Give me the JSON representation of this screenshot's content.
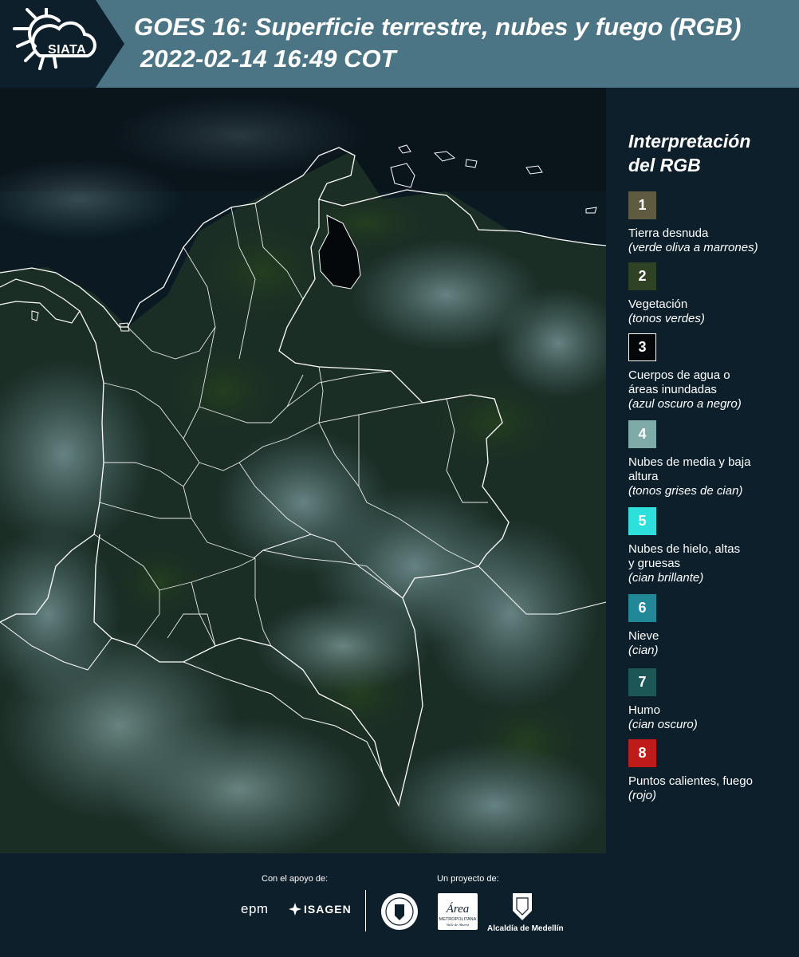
{
  "header": {
    "logo_text": "SIATA",
    "title_line1": "GOES 16: Superficie terrestre, nubes y fuego (RGB)",
    "title_line2": "2022-02-14 16:49 COT"
  },
  "legend": {
    "title_line1": "Interpretación",
    "title_line2": "del RGB",
    "items": [
      {
        "number": "1",
        "color": "#5e5b40",
        "label": "Tierra desnuda",
        "sub": "(verde oliva a marrones)"
      },
      {
        "number": "2",
        "color": "#2f4224",
        "label": "Vegetación",
        "sub": "(tonos verdes)"
      },
      {
        "number": "3",
        "color": "#05080b",
        "label": "Cuerpos de agua o áreas inundadas",
        "sub": "(azul oscuro a negro)"
      },
      {
        "number": "4",
        "color": "#7eaaa8",
        "label": "Nubes de media y baja altura",
        "sub": "(tonos grises de cian)"
      },
      {
        "number": "5",
        "color": "#2de0dc",
        "label": "Nubes de hielo, altas y gruesas",
        "sub": "(cian brillante)"
      },
      {
        "number": "6",
        "color": "#218898",
        "label": "Nieve",
        "sub": "(cian)"
      },
      {
        "number": "7",
        "color": "#1d5656",
        "label": "Humo",
        "sub": "(cian oscuro)"
      },
      {
        "number": "8",
        "color": "#c01b1b",
        "label": "Puntos calientes, fuego",
        "sub": "(rojo)"
      }
    ]
  },
  "footer": {
    "support_label": "Con el apoyo de:",
    "project_label": "Un proyecto de:",
    "epm": "epm",
    "isagen": "ISAGEN",
    "area_line1": "Área",
    "area_line2": "METROPOLITANA",
    "area_line3": "Valle de Aburrá",
    "alcaldia": "Alcaldía de Medellín"
  }
}
